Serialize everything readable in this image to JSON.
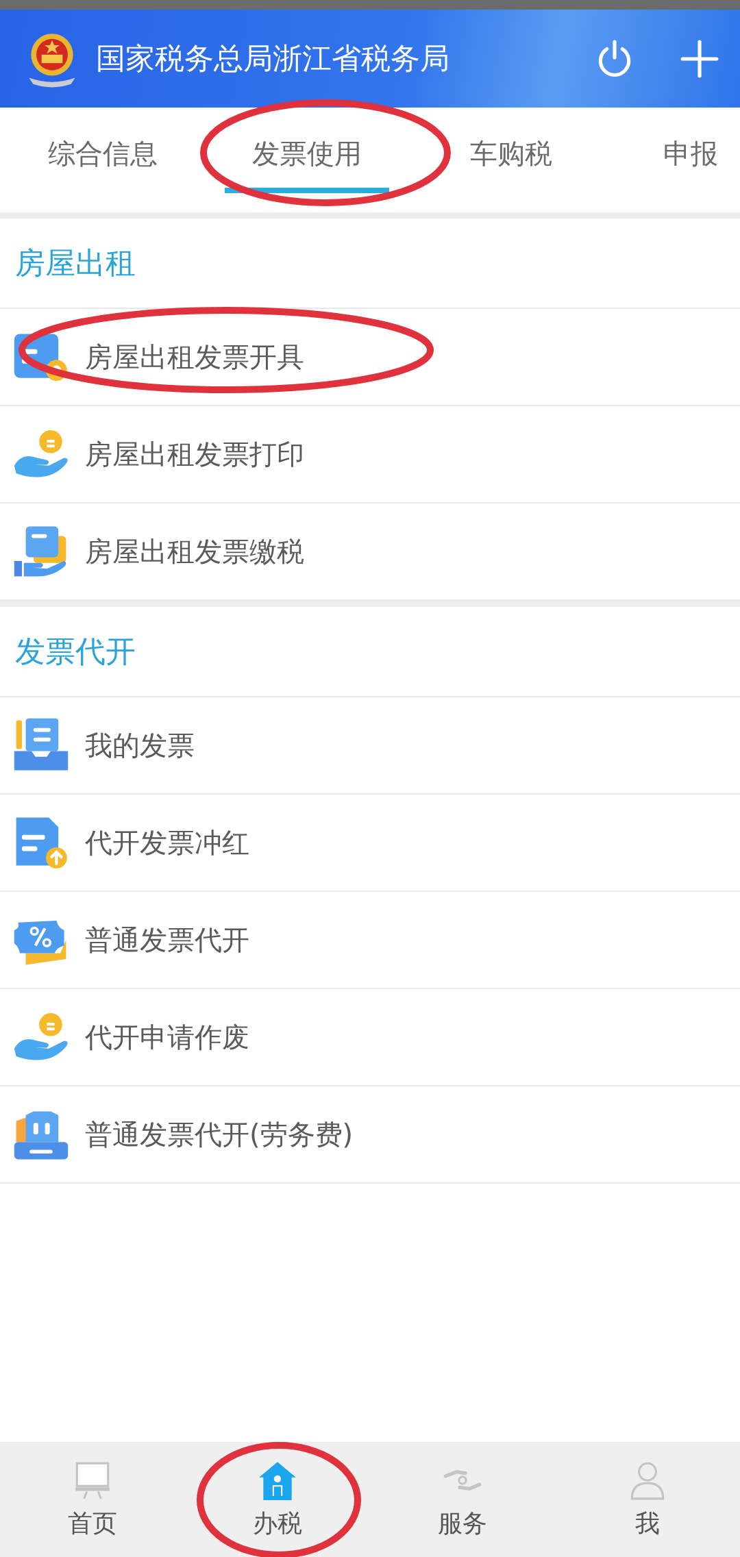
{
  "header": {
    "title": "国家税务总局浙江省税务局"
  },
  "tabs": [
    {
      "label": "综合信息",
      "selected": false
    },
    {
      "label": "发票使用",
      "selected": true
    },
    {
      "label": "车购税",
      "selected": false
    },
    {
      "label": "申报",
      "selected": false
    }
  ],
  "sections": [
    {
      "title": "房屋出租",
      "items": [
        {
          "label": "房屋出租发票开具"
        },
        {
          "label": "房屋出租发票打印"
        },
        {
          "label": "房屋出租发票缴税"
        }
      ]
    },
    {
      "title": "发票代开",
      "items": [
        {
          "label": "我的发票"
        },
        {
          "label": "代开发票冲红"
        },
        {
          "label": "普通发票代开"
        },
        {
          "label": "代开申请作废"
        },
        {
          "label": "普通发票代开(劳务费)"
        }
      ]
    }
  ],
  "bottom_nav": [
    {
      "label": "首页",
      "selected": false
    },
    {
      "label": "办税",
      "selected": true
    },
    {
      "label": "服务",
      "selected": false
    },
    {
      "label": "我",
      "selected": false
    }
  ]
}
